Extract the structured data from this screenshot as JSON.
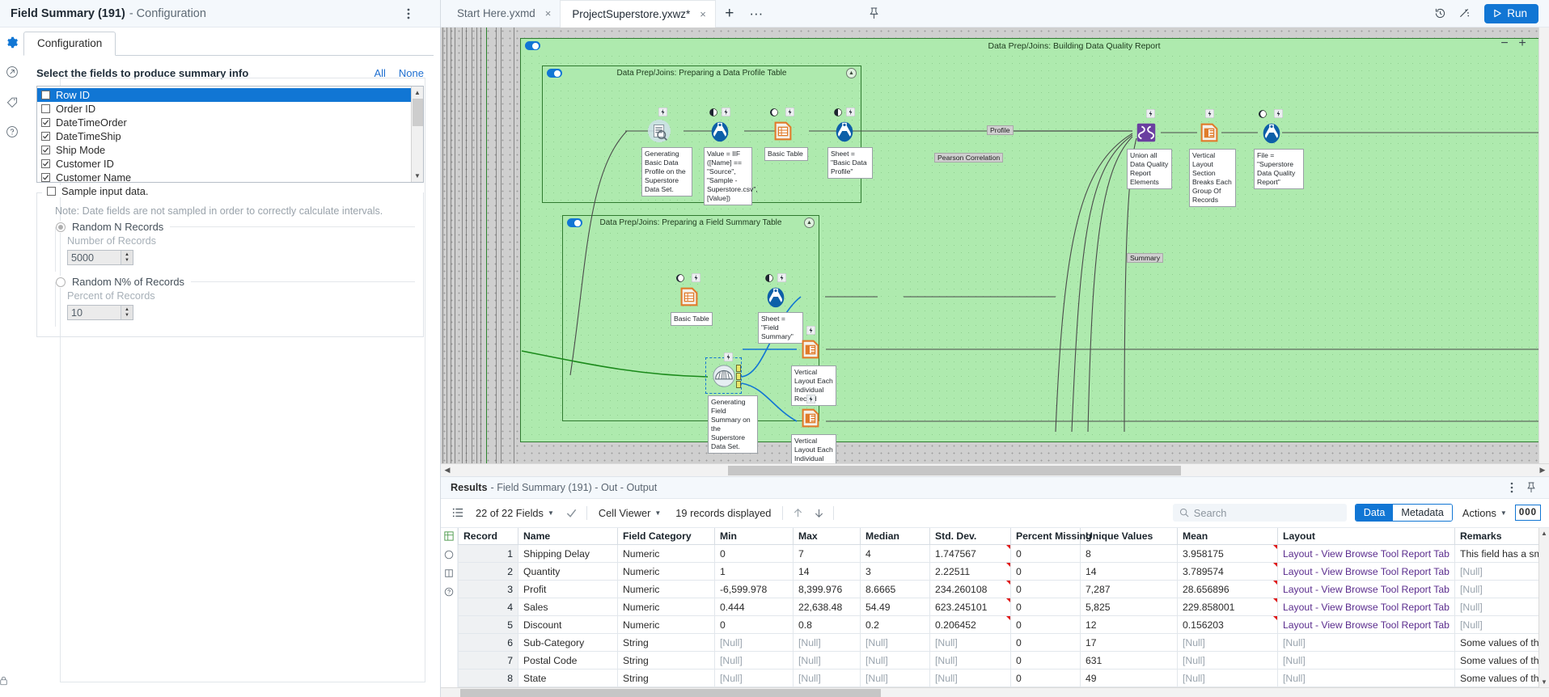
{
  "config": {
    "title": "Field Summary (191)",
    "title_suffix": "- Configuration",
    "tab": "Configuration",
    "prompt": "Select the fields to produce summary info",
    "link_all": "All",
    "link_none": "None",
    "fields": [
      {
        "label": "Row ID",
        "checked": false,
        "selected": true
      },
      {
        "label": "Order ID",
        "checked": false,
        "selected": false
      },
      {
        "label": "DateTimeOrder",
        "checked": true,
        "selected": false
      },
      {
        "label": "DateTimeShip",
        "checked": true,
        "selected": false
      },
      {
        "label": "Ship Mode",
        "checked": true,
        "selected": false
      },
      {
        "label": "Customer ID",
        "checked": true,
        "selected": false
      },
      {
        "label": "Customer Name",
        "checked": true,
        "selected": false
      }
    ],
    "sample_label": "Sample input data.",
    "sample_checked": false,
    "note": "Note: Date fields are not sampled in order to correctly calculate intervals.",
    "random_n_label": "Random N Records",
    "random_n_selected": true,
    "number_of_records_label": "Number of Records",
    "number_of_records_value": "5000",
    "random_pct_label": "Random N% of Records",
    "random_pct_selected": false,
    "percent_of_records_label": "Percent of Records",
    "percent_of_records_value": "10",
    "rail_icons": [
      "gear-icon",
      "arrow-out-icon",
      "tag-icon",
      "help-icon",
      "lock-icon"
    ]
  },
  "topbar": {
    "tabs": [
      {
        "label": "Start Here.yxmd",
        "active": false,
        "close": "×"
      },
      {
        "label": "ProjectSuperstore.yxwz*",
        "active": true,
        "close": "×"
      }
    ],
    "plus": "+",
    "more": "···",
    "run_label": "Run",
    "accent": "#1176d4"
  },
  "canvas": {
    "zoom_out": "−",
    "zoom_in": "+",
    "containers": [
      {
        "name": "Data Prep/Joins: Building Data Quality Report"
      },
      {
        "name": "Data Prep/Joins: Preparing a Data Profile Table"
      },
      {
        "name": "Data Prep/Joins: Preparing a Field Summary Table"
      }
    ],
    "annotations": [
      "Generating Basic Data Profile on the Superstore Data Set.",
      "Value = IIF ([Name] == \"Source\", \"Sample - Superstore.csv\", [Value])",
      "Basic Table",
      "Sheet = \"Basic Data Profile\"",
      "Union all Data Quality Report Elements",
      "Vertical Layout Section Breaks Each Group Of Records",
      "File = \"Superstore Data Quality Report\"",
      "Basic Table",
      "Sheet = \"Field Summary\"",
      "Generating Field Summary on the Superstore Data Set.",
      "Vertical Layout Each Individual Record",
      "Vertical Layout Each Individual Record"
    ],
    "wire_labels": [
      "Profile",
      "Pearson Correlation",
      "Summary"
    ]
  },
  "results": {
    "title": "Results",
    "subtitle": "- Field Summary (191) - Out - Output",
    "fields_count": "22 of 22 Fields",
    "viewer": "Cell Viewer",
    "records_displayed": "19 records displayed",
    "search_placeholder": "Search",
    "seg_data": "Data",
    "seg_metadata": "Metadata",
    "actions": "Actions",
    "zero_badge": "000",
    "columns": [
      "Record",
      "Name",
      "Field Category",
      "Min",
      "Max",
      "Median",
      "Std. Dev.",
      "Percent Missing",
      "Unique Values",
      "Mean",
      "Layout",
      "Remarks"
    ],
    "rows": [
      {
        "record": "1",
        "name": "Shipping Delay",
        "cat": "Numeric",
        "min": "0",
        "max": "7",
        "median": "4",
        "std": "1.747567",
        "pct": "0",
        "uniq": "8",
        "mean": "3.958175",
        "layout": "Layout - View Browse Tool Report Tab",
        "remarks": "This field has a small"
      },
      {
        "record": "2",
        "name": "Quantity",
        "cat": "Numeric",
        "min": "1",
        "max": "14",
        "median": "3",
        "std": "2.22511",
        "pct": "0",
        "uniq": "14",
        "mean": "3.789574",
        "layout": "Layout - View Browse Tool Report Tab",
        "remarks": "[Null]"
      },
      {
        "record": "3",
        "name": "Profit",
        "cat": "Numeric",
        "min": "-6,599.978",
        "max": "8,399.976",
        "median": "8.6665",
        "std": "234.260108",
        "pct": "0",
        "uniq": "7,287",
        "mean": "28.656896",
        "layout": "Layout - View Browse Tool Report Tab",
        "remarks": "[Null]"
      },
      {
        "record": "4",
        "name": "Sales",
        "cat": "Numeric",
        "min": "0.444",
        "max": "22,638.48",
        "median": "54.49",
        "std": "623.245101",
        "pct": "0",
        "uniq": "5,825",
        "mean": "229.858001",
        "layout": "Layout - View Browse Tool Report Tab",
        "remarks": "[Null]"
      },
      {
        "record": "5",
        "name": "Discount",
        "cat": "Numeric",
        "min": "0",
        "max": "0.8",
        "median": "0.2",
        "std": "0.206452",
        "pct": "0",
        "uniq": "12",
        "mean": "0.156203",
        "layout": "Layout - View Browse Tool Report Tab",
        "remarks": "[Null]"
      },
      {
        "record": "6",
        "name": "Sub-Category",
        "cat": "String",
        "min": "[Null]",
        "max": "[Null]",
        "median": "[Null]",
        "std": "[Null]",
        "pct": "0",
        "uniq": "17",
        "mean": "[Null]",
        "layout": "[Null]",
        "remarks": "Some values of this fi"
      },
      {
        "record": "7",
        "name": "Postal Code",
        "cat": "String",
        "min": "[Null]",
        "max": "[Null]",
        "median": "[Null]",
        "std": "[Null]",
        "pct": "0",
        "uniq": "631",
        "mean": "[Null]",
        "layout": "[Null]",
        "remarks": "Some values of this fi"
      },
      {
        "record": "8",
        "name": "State",
        "cat": "String",
        "min": "[Null]",
        "max": "[Null]",
        "median": "[Null]",
        "std": "[Null]",
        "pct": "0",
        "uniq": "49",
        "mean": "[Null]",
        "layout": "[Null]",
        "remarks": "Some values of this fi"
      }
    ]
  }
}
